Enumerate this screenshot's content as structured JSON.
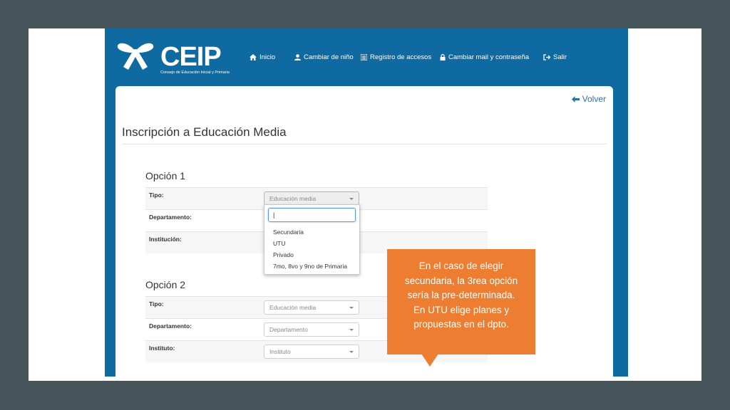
{
  "app": {
    "logo_text": "CEIP",
    "logo_subtitle": "Consejo de Educación Inicial y Primaria"
  },
  "nav": {
    "items": [
      {
        "label": "Inicio",
        "icon": "home-icon"
      },
      {
        "label": "Cambiar de niño",
        "icon": "user-icon"
      },
      {
        "label": "Registro de accesos",
        "icon": "list-icon"
      },
      {
        "label": "Cambiar mail y contraseña",
        "icon": "lock-icon"
      },
      {
        "label": "Salir",
        "icon": "logout-icon"
      }
    ]
  },
  "panel": {
    "back_label": "Volver",
    "title": "Inscripción a Educación Media"
  },
  "option1": {
    "title": "Opción 1",
    "rows": [
      {
        "label": "Tipo:",
        "value": "Educación media"
      },
      {
        "label": "Departamento:"
      },
      {
        "label": "Institución:"
      }
    ]
  },
  "dropdown": {
    "search_value": "|",
    "options": [
      "Secundaria",
      "UTU",
      "Privado",
      "7mo, 8vo y 9no de Primaria"
    ]
  },
  "option2": {
    "title": "Opción 2",
    "rows": [
      {
        "label": "Tipo:",
        "value": "Educación media"
      },
      {
        "label": "Departamento:",
        "value": "Departamento"
      },
      {
        "label": "Instituto:",
        "value": "Instituto"
      }
    ]
  },
  "callout": {
    "lines": [
      "En el caso de elegir",
      "secundaria, la 3rea opción",
      "sería la pre-determinada.",
      "En UTU elige planes y",
      "propuestas en el dpto."
    ]
  },
  "colors": {
    "background": "#46555a",
    "header": "#0e6aa0",
    "callout": "#ed7d31",
    "link": "#2a6fb0"
  }
}
